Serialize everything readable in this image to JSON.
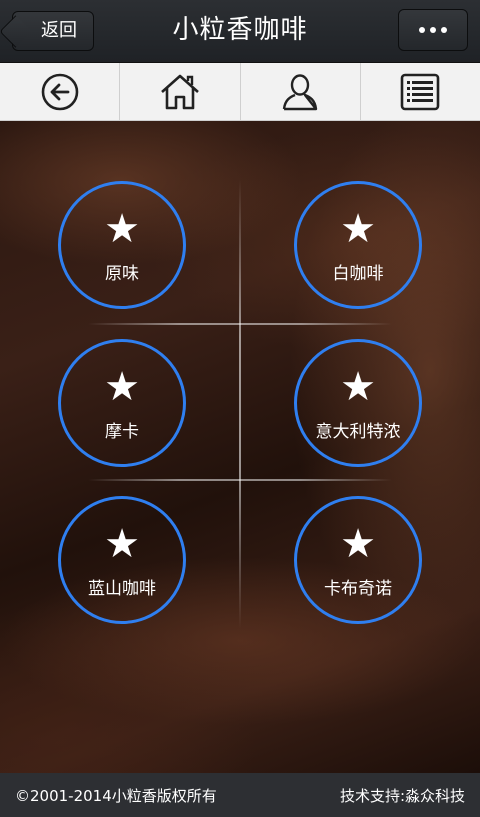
{
  "header": {
    "back_label": "返回",
    "title": "小粒香咖啡",
    "more_icon": "more-dots-icon"
  },
  "nav": [
    {
      "icon": "back-arrow-icon"
    },
    {
      "icon": "home-icon"
    },
    {
      "icon": "user-icon"
    },
    {
      "icon": "list-icon"
    }
  ],
  "menu": [
    {
      "label": "原味",
      "icon": "star-icon"
    },
    {
      "label": "白咖啡",
      "icon": "star-icon"
    },
    {
      "label": "摩卡",
      "icon": "star-icon"
    },
    {
      "label": "意大利特浓",
      "icon": "star-icon"
    },
    {
      "label": "蓝山咖啡",
      "icon": "star-icon"
    },
    {
      "label": "卡布奇诺",
      "icon": "star-icon"
    }
  ],
  "footer": {
    "copyright": "©2001-2014小粒香版权所有",
    "support": "技术支持:淼众科技"
  },
  "colors": {
    "ring": "#2f7ff0",
    "titlebar": "#2c2f33",
    "navbar": "#f2f2f2"
  }
}
